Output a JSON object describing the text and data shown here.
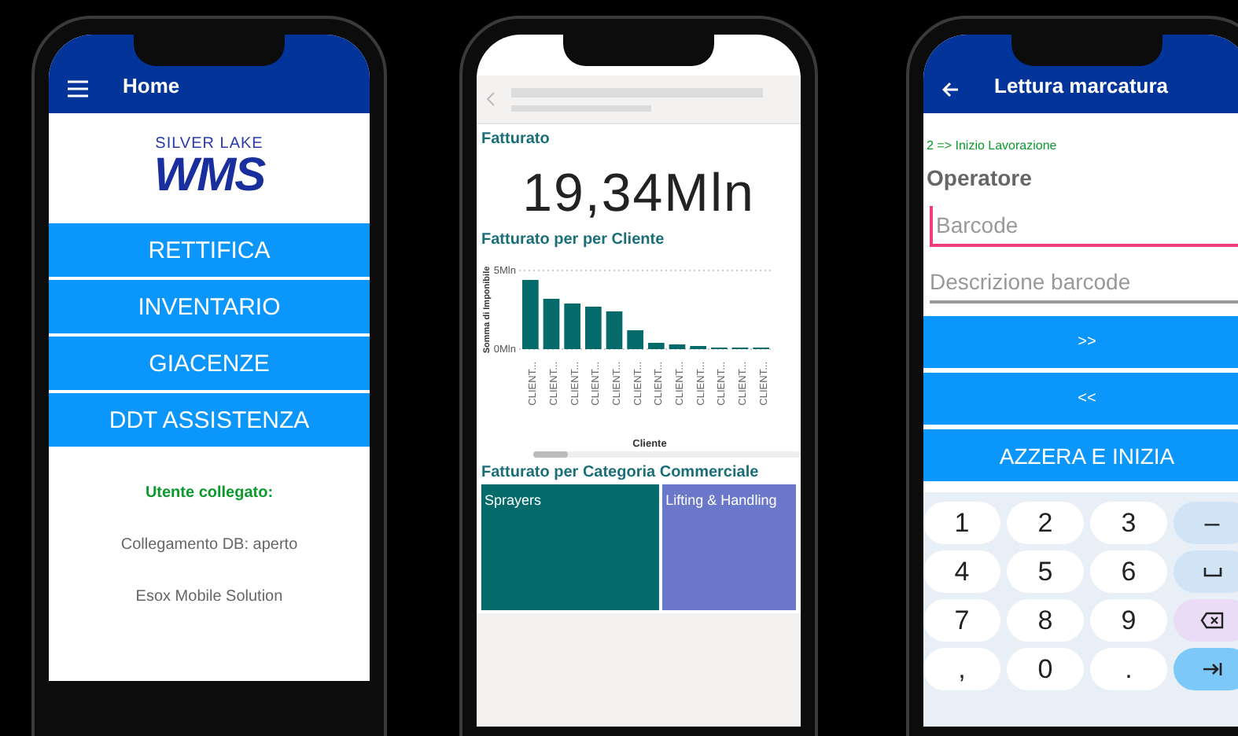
{
  "phones": [
    {
      "kind": "menu",
      "title": "Home",
      "logo": {
        "top": "SILVER LAKE",
        "main": "WMS"
      },
      "buttons": [
        "RETTIFICA",
        "INVENTARIO",
        "GIACENZE",
        "DDT ASSISTENZA"
      ],
      "status_title": "Utente collegato:",
      "lines": [
        "Collegamento DB: aperto",
        "Esox Mobile Solution"
      ]
    },
    {
      "kind": "report",
      "kpi": {
        "title": "Fatturato",
        "value": "19,34Mln"
      },
      "chart": {
        "title": "Fatturato per per Cliente",
        "chart_data": {
          "type": "bar",
          "xlabel": "Cliente",
          "ylabel": "Somma di Imponibile",
          "categories": [
            "CLIENT...",
            "CLIENT...",
            "CLIENT...",
            "CLIENT...",
            "CLIENT...",
            "CLIENT...",
            "CLIENT...",
            "CLIENT...",
            "CLIENT...",
            "CLIENT...",
            "CLIENT...",
            "CLIENT..."
          ],
          "values": [
            4.4,
            3.2,
            2.9,
            2.7,
            2.4,
            1.2,
            0.4,
            0.3,
            0.2,
            0.1,
            0.1,
            0.1
          ],
          "ylim": [
            0,
            5
          ],
          "yticks": [
            {
              "value": 0,
              "label": "0Mln"
            },
            {
              "value": 5,
              "label": "5Mln"
            }
          ]
        }
      },
      "treemap": {
        "title": "Fatturato per Categoria Commerciale",
        "tiles": [
          {
            "label": "Sprayers",
            "color": "#046a6a"
          },
          {
            "label": "Lifting & Handling",
            "color": "#6b78c9"
          }
        ]
      }
    },
    {
      "kind": "form",
      "title": "Lettura marcatura",
      "step": "2 => Inizio Lavorazione",
      "section": "Operatore",
      "fields": [
        {
          "placeholder": "Barcode",
          "focused": true
        },
        {
          "placeholder": "Descrizione barcode",
          "focused": false
        }
      ],
      "buttons": [
        ">>",
        "<<",
        "AZZERA E INIZIA"
      ],
      "keys": [
        {
          "kind": "char",
          "label": "1"
        },
        {
          "kind": "char",
          "label": "2"
        },
        {
          "kind": "char",
          "label": "3"
        },
        {
          "kind": "fn",
          "label": "–"
        },
        {
          "kind": "char",
          "label": "4"
        },
        {
          "kind": "char",
          "label": "5"
        },
        {
          "kind": "char",
          "label": "6"
        },
        {
          "kind": "space"
        },
        {
          "kind": "char",
          "label": "7"
        },
        {
          "kind": "char",
          "label": "8"
        },
        {
          "kind": "char",
          "label": "9"
        },
        {
          "kind": "backspace"
        },
        {
          "kind": "char",
          "label": ","
        },
        {
          "kind": "char",
          "label": "0"
        },
        {
          "kind": "char",
          "label": "."
        },
        {
          "kind": "tab"
        }
      ]
    }
  ]
}
